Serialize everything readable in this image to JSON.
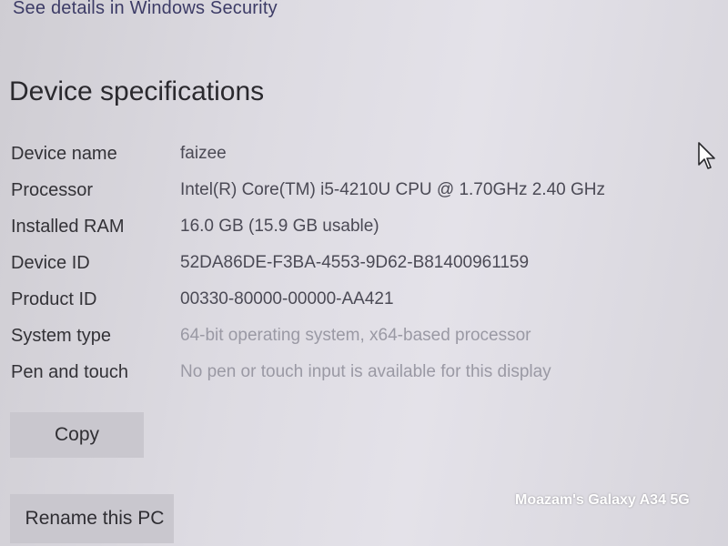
{
  "header": {
    "security_link": "See details in Windows Security"
  },
  "section": {
    "title": "Device specifications"
  },
  "specs": [
    {
      "label": "Device name",
      "value": "faizee"
    },
    {
      "label": "Processor",
      "value": "Intel(R) Core(TM) i5-4210U CPU @ 1.70GHz   2.40 GHz"
    },
    {
      "label": "Installed RAM",
      "value": "16.0 GB (15.9 GB usable)"
    },
    {
      "label": "Device ID",
      "value": "52DA86DE-F3BA-4553-9D62-B81400961159"
    },
    {
      "label": "Product ID",
      "value": "00330-80000-00000-AA421"
    },
    {
      "label": "System type",
      "value": "64-bit operating system, x64-based processor"
    },
    {
      "label": "Pen and touch",
      "value": "No pen or touch input is available for this display"
    }
  ],
  "buttons": {
    "copy_label": "Copy",
    "rename_label": "Rename this PC"
  },
  "watermark": {
    "text": "Moazam's Galaxy A34 5G"
  },
  "icons": {
    "cursor": "mouse-pointer-icon"
  },
  "colors": {
    "link": "#3c3b66",
    "background": "#dddbe2",
    "button": "#c9c7ce"
  }
}
